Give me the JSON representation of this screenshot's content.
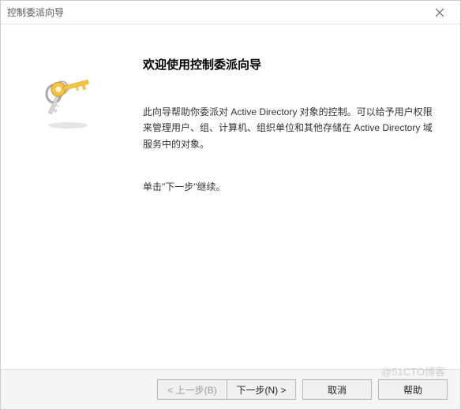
{
  "window": {
    "title": "控制委派向导"
  },
  "content": {
    "heading": "欢迎使用控制委派向导",
    "description": "此向导帮助你委派对 Active Directory 对象的控制。可以给予用户权限来管理用户、组、计算机、组织单位和其他存储在 Active Directory 域服务中的对象。",
    "instruction": "单击\"下一步\"继续。"
  },
  "buttons": {
    "back": "< 上一步(B)",
    "next": "下一步(N) >",
    "cancel": "取消",
    "help": "帮助"
  },
  "watermark": "@51CTO博客"
}
